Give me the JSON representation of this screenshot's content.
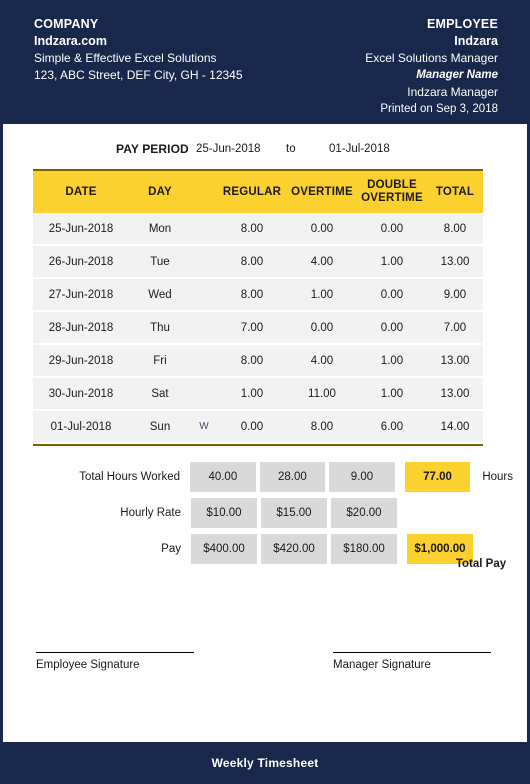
{
  "header": {
    "company": {
      "label": "COMPANY",
      "name": "Indzara.com",
      "tagline": "Simple & Effective Excel Solutions",
      "address": "123, ABC Street, DEF City, GH - 12345"
    },
    "employee": {
      "label": "EMPLOYEE",
      "name": "Indzara",
      "title": "Excel Solutions Manager",
      "manager_label": "Manager Name",
      "manager_name": "Indzara Manager",
      "printed_on": "Printed on Sep 3, 2018"
    }
  },
  "pay_period": {
    "label": "PAY PERIOD",
    "start": "25-Jun-2018",
    "separator": "to",
    "end": "01-Jul-2018"
  },
  "table": {
    "columns": [
      "DATE",
      "DAY",
      "REGULAR",
      "OVERTIME",
      "DOUBLE OVERTIME",
      "TOTAL"
    ],
    "column_double_overtime_line1": "DOUBLE",
    "column_double_overtime_line2": "OVERTIME",
    "rows": [
      {
        "date": "25-Jun-2018",
        "day": "Mon",
        "flag": "",
        "regular": "8.00",
        "overtime": "0.00",
        "double_overtime": "0.00",
        "total": "8.00"
      },
      {
        "date": "26-Jun-2018",
        "day": "Tue",
        "flag": "",
        "regular": "8.00",
        "overtime": "4.00",
        "double_overtime": "1.00",
        "total": "13.00"
      },
      {
        "date": "27-Jun-2018",
        "day": "Wed",
        "flag": "",
        "regular": "8.00",
        "overtime": "1.00",
        "double_overtime": "0.00",
        "total": "9.00"
      },
      {
        "date": "28-Jun-2018",
        "day": "Thu",
        "flag": "",
        "regular": "7.00",
        "overtime": "0.00",
        "double_overtime": "0.00",
        "total": "7.00"
      },
      {
        "date": "29-Jun-2018",
        "day": "Fri",
        "flag": "",
        "regular": "8.00",
        "overtime": "4.00",
        "double_overtime": "1.00",
        "total": "13.00"
      },
      {
        "date": "30-Jun-2018",
        "day": "Sat",
        "flag": "",
        "regular": "1.00",
        "overtime": "11.00",
        "double_overtime": "1.00",
        "total": "13.00"
      },
      {
        "date": "01-Jul-2018",
        "day": "Sun",
        "flag": "W",
        "regular": "0.00",
        "overtime": "8.00",
        "double_overtime": "6.00",
        "total": "14.00"
      }
    ]
  },
  "summary": {
    "total_hours": {
      "label": "Total Hours Worked",
      "regular": "40.00",
      "overtime": "28.00",
      "double_overtime": "9.00",
      "total": "77.00",
      "unit": "Hours"
    },
    "hourly_rate": {
      "label": "Hourly Rate",
      "regular": "$10.00",
      "overtime": "$15.00",
      "double_overtime": "$20.00",
      "total": ""
    },
    "pay": {
      "label": "Pay",
      "regular": "$400.00",
      "overtime": "$420.00",
      "double_overtime": "$180.00",
      "total": "$1,000.00"
    },
    "total_pay_label": "Total Pay"
  },
  "signatures": {
    "employee": "Employee Signature",
    "manager": "Manager Signature"
  },
  "footer": {
    "title": "Weekly Timesheet"
  },
  "colors": {
    "navy": "#17284a",
    "accent_yellow": "#fbd130",
    "row_gray": "#f2f2f2",
    "cell_gray": "#d9d9d9",
    "rule_gold": "#7f6000"
  }
}
